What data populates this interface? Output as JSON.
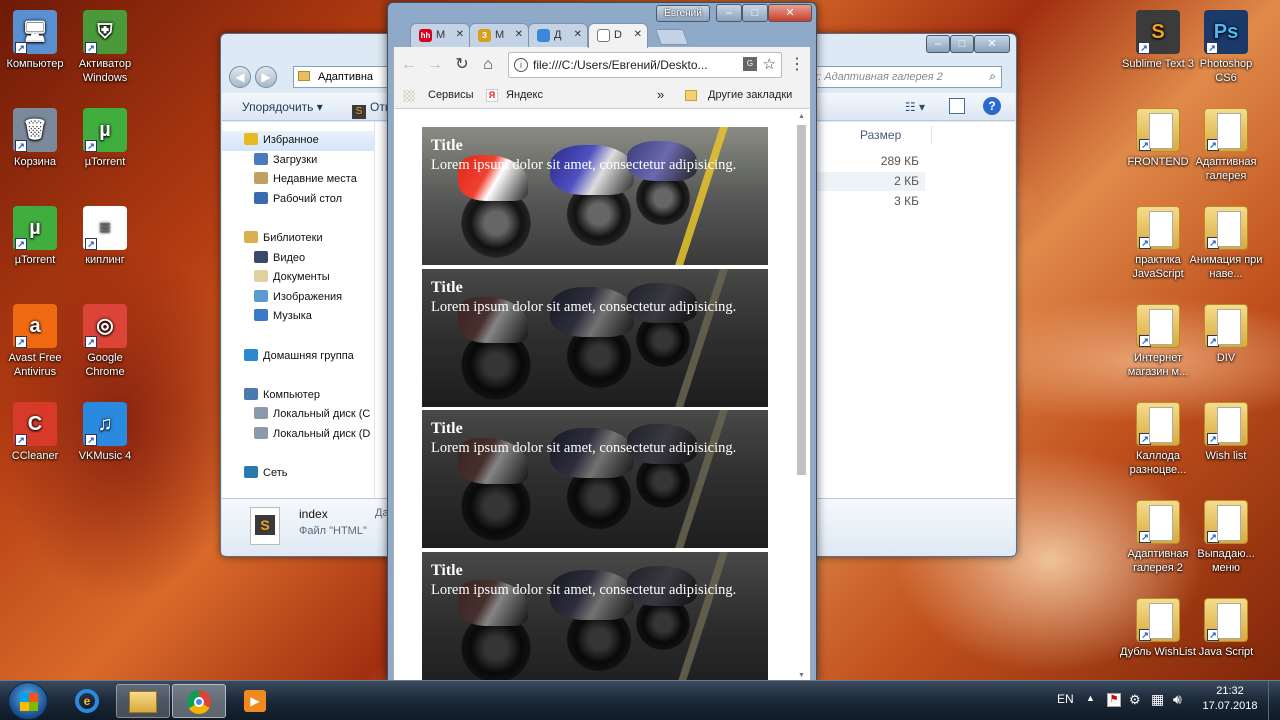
{
  "desktop": {
    "left_icons": [
      {
        "label": "Компьютер",
        "icon": "computer-icon",
        "color": "#5a8fd0"
      },
      {
        "label": "Активатор Windows",
        "icon": "windows-shield-icon",
        "color": "#4a9a3a"
      },
      {
        "label": "Корзина",
        "icon": "recycle-bin-icon",
        "color": "#7a8a9a"
      },
      {
        "label": "µTorrent",
        "icon": "utorrent-icon",
        "color": "#3fae3f"
      },
      {
        "label": "µTorrent",
        "icon": "utorrent-icon",
        "color": "#3fae3f"
      },
      {
        "label": "киплинг",
        "icon": "document-icon",
        "color": "#ffffff"
      },
      {
        "label": "Avast Free Antivirus",
        "icon": "avast-icon",
        "color": "#f06a12"
      },
      {
        "label": "Google Chrome",
        "icon": "chrome-icon",
        "color": "#db4437"
      },
      {
        "label": "CCleaner",
        "icon": "ccleaner-icon",
        "color": "#d83a2a"
      },
      {
        "label": "VKMusic 4",
        "icon": "vkmusic-icon",
        "color": "#2a8ae0"
      }
    ],
    "right_icons": [
      {
        "label": "Sublime Text 3",
        "icon": "sublime-icon",
        "color": "#3b3b3b"
      },
      {
        "label": "Photoshop CS6",
        "icon": "photoshop-icon",
        "color": "#1b3a6a"
      },
      {
        "label": "FRONTEND",
        "icon": "folder-icon"
      },
      {
        "label": "Адаптивная галерея",
        "icon": "folder-icon"
      },
      {
        "label": "практика JavaScript",
        "icon": "folder-icon"
      },
      {
        "label": "Анимация при наве...",
        "icon": "folder-icon"
      },
      {
        "label": "Интернет магазин м...",
        "icon": "folder-icon"
      },
      {
        "label": "DIV",
        "icon": "folder-icon"
      },
      {
        "label": "Каллода разноцве...",
        "icon": "folder-icon"
      },
      {
        "label": "Wish list",
        "icon": "folder-icon"
      },
      {
        "label": "Адаптивная галерея 2",
        "icon": "folder-icon"
      },
      {
        "label": "Выпадаю... меню",
        "icon": "folder-icon"
      },
      {
        "label": "Дубль WishList",
        "icon": "folder-icon"
      },
      {
        "label": "Java Script",
        "icon": "folder-icon"
      }
    ]
  },
  "explorer": {
    "path_label": "Адаптивна",
    "search_placeholder": "к: Адаптивная галерея 2",
    "organize_label": "Упорядочить",
    "toolbar_item": "Отк",
    "size_header": "Размер",
    "sizes": [
      "289 КБ",
      "2 КБ",
      "3 КБ"
    ],
    "nav": [
      {
        "label": "Избранное",
        "level": 0,
        "icon": "star-icon",
        "color": "#e8b820"
      },
      {
        "label": "Загрузки",
        "level": 1,
        "icon": "downloads-icon",
        "color": "#4a7ac0"
      },
      {
        "label": "Недавние места",
        "level": 1,
        "icon": "recent-places-icon",
        "color": "#c0a060"
      },
      {
        "label": "Рабочий стол",
        "level": 1,
        "icon": "desktop-icon",
        "color": "#3a6ab0"
      },
      {
        "label": "",
        "level": -1
      },
      {
        "label": "Библиотеки",
        "level": 0,
        "icon": "libraries-icon",
        "color": "#d8b050"
      },
      {
        "label": "Видео",
        "level": 1,
        "icon": "video-icon",
        "color": "#3a4a6a"
      },
      {
        "label": "Документы",
        "level": 1,
        "icon": "documents-icon",
        "color": "#e0d0a0"
      },
      {
        "label": "Изображения",
        "level": 1,
        "icon": "images-icon",
        "color": "#5a9ad0"
      },
      {
        "label": "Музыка",
        "level": 1,
        "icon": "music-icon",
        "color": "#3a7ac8"
      },
      {
        "label": "",
        "level": -1
      },
      {
        "label": "Домашняя группа",
        "level": 0,
        "icon": "homegroup-icon",
        "color": "#2a8ad0"
      },
      {
        "label": "",
        "level": -1
      },
      {
        "label": "Компьютер",
        "level": 0,
        "icon": "computer-icon",
        "color": "#4a7ab0"
      },
      {
        "label": "Локальный диск (C",
        "level": 1,
        "icon": "disk-icon",
        "color": "#8a9aaa"
      },
      {
        "label": "Локальный диск (D",
        "level": 1,
        "icon": "disk-icon",
        "color": "#8a9aaa"
      },
      {
        "label": "",
        "level": -1
      },
      {
        "label": "Сеть",
        "level": 0,
        "icon": "network-icon",
        "color": "#2a7ab0"
      }
    ],
    "details_name": "index",
    "details_type": "Файл \"HTML\"",
    "details_extra": "Да"
  },
  "chrome": {
    "profile": "Евгений",
    "tabs": [
      {
        "label": "M",
        "fav": "hh",
        "fav_color": "#d6001c"
      },
      {
        "label": "M",
        "fav": "З",
        "fav_color": "#d8a018"
      },
      {
        "label": "Д",
        "fav": "",
        "fav_color": "#3a88d8"
      },
      {
        "label": "D",
        "fav": "",
        "fav_color": "#ffffff",
        "active": true
      }
    ],
    "url": "file:///C:/Users/Евгений/Deskto...",
    "bookmarks": {
      "services": "Сервисы",
      "yandex": "Яндекс",
      "more": "»",
      "other": "Другие закладки"
    },
    "cards": [
      {
        "title": "Title",
        "text": "Lorem ipsum dolor sit amet, consectetur adipisicing."
      },
      {
        "title": "Title",
        "text": "Lorem ipsum dolor sit amet, consectetur adipisicing."
      },
      {
        "title": "Title",
        "text": "Lorem ipsum dolor sit amet, consectetur adipisicing."
      },
      {
        "title": "Title",
        "text": "Lorem ipsum dolor sit amet, consectetur adipisicing."
      }
    ]
  },
  "taskbar": {
    "lang": "EN",
    "time": "21:32",
    "date": "17.07.2018"
  }
}
